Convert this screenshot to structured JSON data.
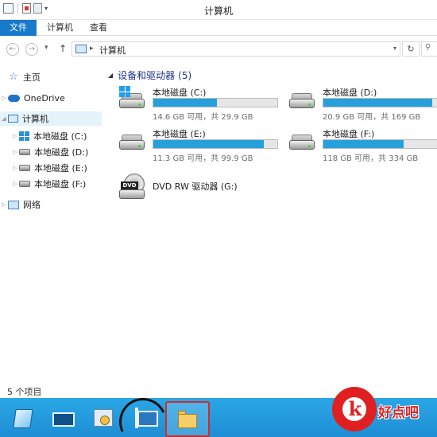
{
  "window": {
    "title": "计算机"
  },
  "ribbon": {
    "file": "文件",
    "tabs": [
      "计算机",
      "查看"
    ]
  },
  "address": {
    "path": "计算机"
  },
  "nav": {
    "items": [
      {
        "label": "主页"
      },
      {
        "label": "OneDrive"
      },
      {
        "label": "计算机"
      },
      {
        "label": "本地磁盘 (C:)"
      },
      {
        "label": "本地磁盘 (D:)"
      },
      {
        "label": "本地磁盘 (E:)"
      },
      {
        "label": "本地磁盘 (F:)"
      },
      {
        "label": "网络"
      }
    ]
  },
  "content": {
    "group_title": "设备和驱动器",
    "group_count": "(5)",
    "drives": [
      {
        "name": "本地磁盘 (C:)",
        "info": "14.6 GB 可用，共 29.9 GB",
        "used_fraction": 0.51
      },
      {
        "name": "本地磁盘 (D:)",
        "info": "20.9 GB 可用，共 169 GB",
        "used_fraction": 0.88
      },
      {
        "name": "本地磁盘 (E:)",
        "info": "11.3 GB 可用，共 99.9 GB",
        "used_fraction": 0.89
      },
      {
        "name": "本地磁盘 (F:)",
        "info": "118 GB 可用，共 334 GB",
        "used_fraction": 0.65
      }
    ],
    "dvd": {
      "name": "DVD RW 驱动器 (G:)",
      "badge": "DVD"
    }
  },
  "status": {
    "text": "5 个项目"
  },
  "watermark": {
    "text": "好点吧",
    "glyph": "k"
  },
  "colors": {
    "accent": "#1979ca",
    "bar": "#26a0da",
    "taskbar": "#1e8ed4"
  }
}
